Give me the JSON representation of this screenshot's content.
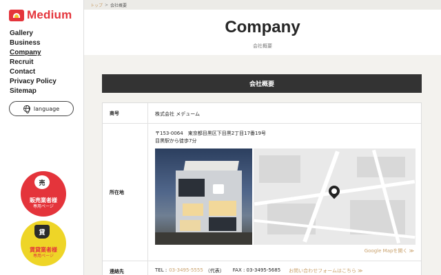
{
  "sidebar": {
    "logo_text": "Medium",
    "nav": [
      {
        "label": "Gallery"
      },
      {
        "label": "Business"
      },
      {
        "label": "Company"
      },
      {
        "label": "Recruit"
      },
      {
        "label": "Contact"
      },
      {
        "label": "Privacy Policy"
      },
      {
        "label": "Sitemap"
      }
    ],
    "language_label": "language",
    "badge_sell": {
      "icon": "売",
      "title": "販売業者様",
      "sub": "専用ページ"
    },
    "badge_rent": {
      "icon": "貸",
      "title": "賃貸業者様",
      "sub": "専用ページ"
    }
  },
  "breadcrumb": {
    "home": "トップ",
    "sep": ">",
    "current": "会社概要"
  },
  "page": {
    "title": "Company",
    "subtitle": "会社概要"
  },
  "section": {
    "title": "会社概要"
  },
  "table": {
    "name_label": "商号",
    "name_value": "株式会社 メデューム",
    "address_label": "所在地",
    "address_line1": "〒153-0064　東京都目黒区下目黒2丁目17番19号",
    "address_line2": "目黒駅から徒歩7分",
    "map_link": "Google Mapを開く ≫",
    "contact_label": "連絡先",
    "tel_prefix": "TEL :",
    "tel_value": "03-3495-5555",
    "tel_rep": "（代表）",
    "fax": "FAX : 03-3495-5685",
    "contact_link": "お問い合わせフォームはこちら ≫"
  },
  "colors": {
    "accent": "#e4343b",
    "gold": "#c8a06b",
    "yellow": "#eed527",
    "dark": "#333333"
  }
}
